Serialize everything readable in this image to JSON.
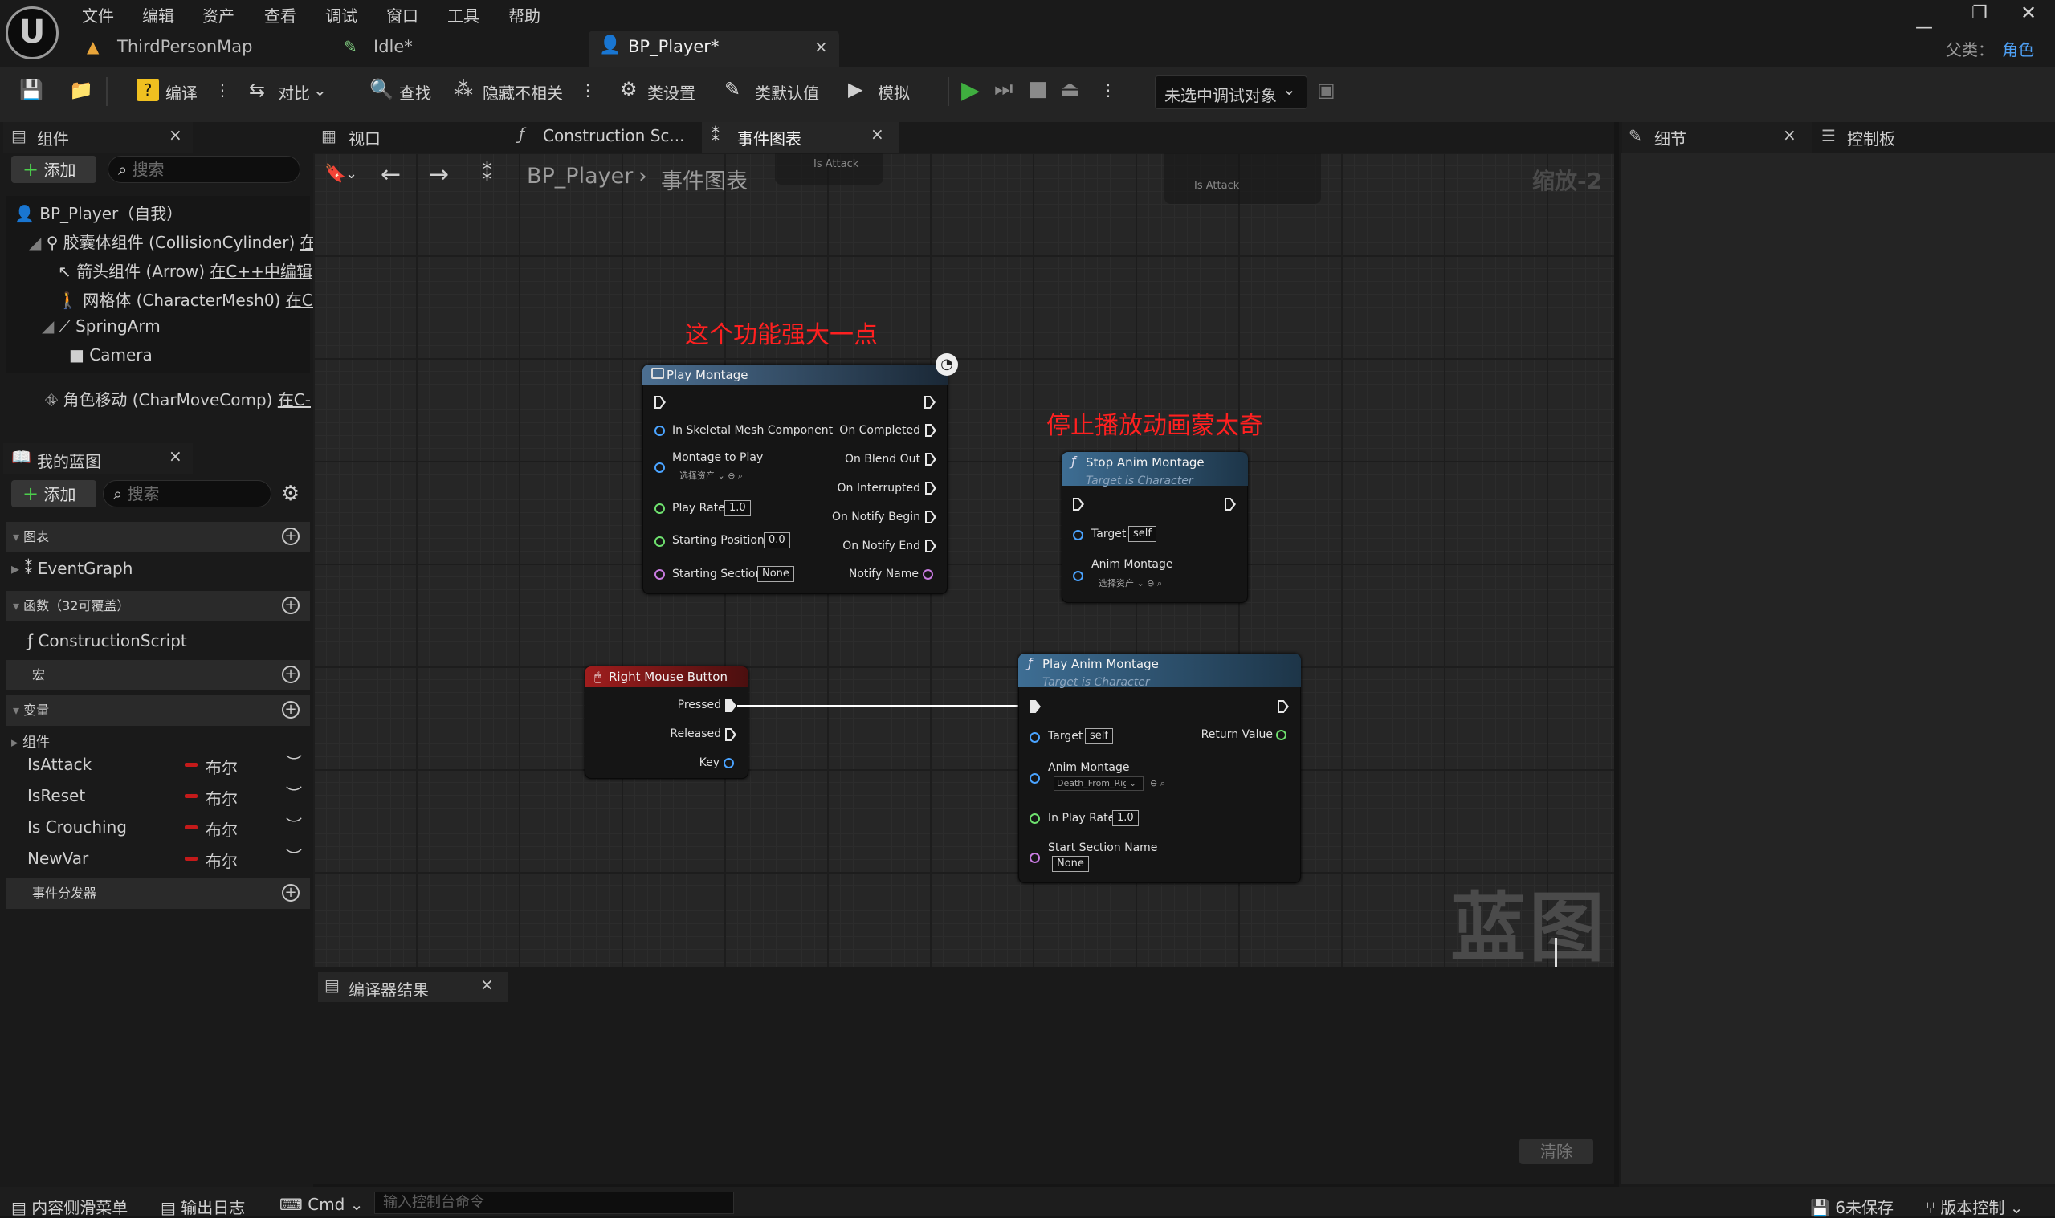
{
  "menu": [
    "文件",
    "编辑",
    "资产",
    "查看",
    "调试",
    "窗口",
    "工具",
    "帮助"
  ],
  "doc_tabs": {
    "map": "ThirdPersonMap",
    "idle": "Idle*",
    "bp": "BP_Player*"
  },
  "parent": {
    "label": "父类：",
    "value": "角色"
  },
  "toolbar": {
    "compile": "编译",
    "diff": "对比",
    "find": "查找",
    "hide": "隐藏不相关",
    "class_settings": "类设置",
    "class_defaults": "类默认值",
    "simulate": "模拟",
    "debug_target": "未选中调试对象"
  },
  "components": {
    "tab": "组件",
    "add": "添加",
    "search_ph": "搜索",
    "items": [
      {
        "name": "BP_Player（自我）",
        "edit": ""
      },
      {
        "name": "胶囊体组件 (CollisionCylinder)",
        "edit": "在"
      },
      {
        "name": "箭头组件 (Arrow)",
        "edit": "在C++中编辑"
      },
      {
        "name": "网格体 (CharacterMesh0)",
        "edit": "在C-"
      },
      {
        "name": "SpringArm",
        "edit": ""
      },
      {
        "name": "Camera",
        "edit": ""
      },
      {
        "name": "角色移动 (CharMoveComp)",
        "edit": "在C-"
      }
    ]
  },
  "my_blueprint": {
    "tab": "我的蓝图",
    "add": "添加",
    "search_ph": "搜索",
    "graphs": "图表",
    "event_graph": "EventGraph",
    "functions": "函数（32可覆盖）",
    "construction": "ConstructionScript",
    "macros": "宏",
    "variables": "变量",
    "var_group": "组件",
    "vars": [
      {
        "name": "IsAttack",
        "type": "布尔"
      },
      {
        "name": "IsReset",
        "type": "布尔"
      },
      {
        "name": "Is Crouching",
        "type": "布尔"
      },
      {
        "name": "NewVar",
        "type": "布尔"
      }
    ],
    "dispatchers": "事件分发器"
  },
  "center_tabs": {
    "viewport": "视口",
    "construction": "Construction Sc...",
    "event_graph": "事件图表"
  },
  "breadcrumb": {
    "bp": "BP_Player",
    "graph": "事件图表",
    "zoom": "缩放-2"
  },
  "faded": {
    "is_attack1": "Is Attack",
    "is_attack2": "Is Attack"
  },
  "annotations": {
    "a1": "这个功能强大一点",
    "a2": "停止播放动画蒙太奇"
  },
  "play_montage": {
    "title": "Play Montage",
    "in": {
      "mesh": "In Skeletal Mesh Component",
      "montage": "Montage to Play",
      "montage_sel": "选择资产",
      "rate": "Play Rate",
      "rate_v": "1.0",
      "pos": "Starting Position",
      "pos_v": "0.0",
      "section": "Starting Section",
      "section_v": "None"
    },
    "out": {
      "completed": "On Completed",
      "blend": "On Blend Out",
      "interrupted": "On Interrupted",
      "nbegin": "On Notify Begin",
      "nend": "On Notify End",
      "nname": "Notify Name"
    }
  },
  "stop_montage": {
    "title": "Stop Anim Montage",
    "sub": "Target is Character",
    "target": "Target",
    "target_v": "self",
    "montage": "Anim Montage",
    "montage_sel": "选择资产"
  },
  "rmb": {
    "title": "Right Mouse Button",
    "pressed": "Pressed",
    "released": "Released",
    "key": "Key"
  },
  "play_anim": {
    "title": "Play Anim Montage",
    "sub": "Target is Character",
    "target": "Target",
    "target_v": "self",
    "ret": "Return Value",
    "montage": "Anim Montage",
    "montage_sel": "Death_From_Rig",
    "rate": "In Play Rate",
    "rate_v": "1.0",
    "section": "Start Section Name",
    "section_v": "None"
  },
  "watermark": "蓝图",
  "details": {
    "tab": "细节",
    "palette": "控制板"
  },
  "compiler": {
    "tab": "编译器结果",
    "clear": "清除"
  },
  "status": {
    "drawer": "内容侧滑菜单",
    "log": "输出日志",
    "cmd": "Cmd",
    "cmd_ph": "输入控制台命令",
    "unsaved": "6未保存",
    "source": "版本控制"
  },
  "colors": {
    "accent": "#4ea0f5",
    "play": "#3fae3f",
    "exec_wire": "#ffffff",
    "bool": "#c41a1a",
    "annotation": "#ff2020"
  }
}
